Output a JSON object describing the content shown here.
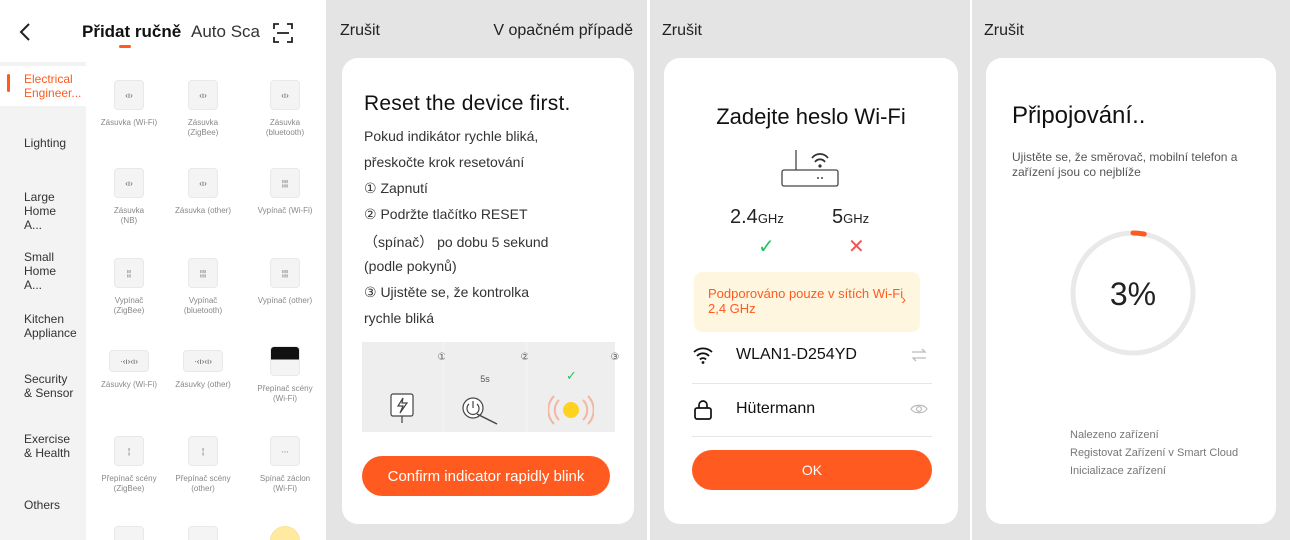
{
  "panel1": {
    "tabs": {
      "active": "Přidat ručně",
      "inactive": "Auto Sca"
    },
    "sidebar": [
      "Electrical Engineer...",
      "Lighting",
      "Large Home A...",
      "Small Home A...",
      "Kitchen Appliance",
      "Security & Sensor",
      "Exercise & Health",
      "Others"
    ],
    "devices": [
      {
        "name": "Zásuvka (Wi-Fi)",
        "sub": ""
      },
      {
        "name": "Zásuvka",
        "sub": "(ZigBee)"
      },
      {
        "name": "Zásuvka",
        "sub": "(bluetooth)"
      },
      {
        "name": "Zásuvka",
        "sub": "(NB)"
      },
      {
        "name": "Zásuvka (other)",
        "sub": ""
      },
      {
        "name": "Vypínač (Wi-Fi)",
        "sub": ""
      },
      {
        "name": "Vypínač",
        "sub": "(ZigBee)"
      },
      {
        "name": "Vypínač",
        "sub": "(bluetooth)"
      },
      {
        "name": "Vypínač (other)",
        "sub": ""
      },
      {
        "name": "Zásuvky (Wi-Fi)",
        "sub": ""
      },
      {
        "name": "Zásuvky (other)",
        "sub": ""
      },
      {
        "name": "Přepínač scény",
        "sub": "(Wi-Fi)"
      },
      {
        "name": "Přepínač scény",
        "sub": "(ZigBee)"
      },
      {
        "name": "Přepínač scény",
        "sub": "(other)"
      },
      {
        "name": "Spínač záclon",
        "sub": "(Wi-Fi)"
      }
    ],
    "accent": "#ff5a1f"
  },
  "panel2": {
    "cancel": "Zrušit",
    "otherwise": "V opačném případě",
    "title": "Reset the device first.",
    "lines": [
      "Pokud indikátor rychle bliká,",
      "přeskočte krok resetování",
      "① Zapnutí",
      "② Podržte tlačítko RESET",
      "（spínač） po dobu 5 sekund",
      "(podle pokynů)",
      "③ Ujistěte se, že kontrolka",
      "rychle bliká"
    ],
    "steps": [
      "①",
      "②",
      "③"
    ],
    "step2_time": "5s",
    "confirm": "Confirm indicator rapidly blink"
  },
  "panel3": {
    "cancel": "Zrušit",
    "title": "Zadejte heslo Wi-Fi",
    "band_24": {
      "num": "2.4",
      "unit": "GHz"
    },
    "band_5": {
      "num": "5",
      "unit": "GHz"
    },
    "notice": "Podporováno pouze v sítích Wi-Fi 2,4 GHz",
    "ssid": "WLAN1-D254YD",
    "password": "Hütermann",
    "ok": "OK"
  },
  "panel4": {
    "cancel": "Zrušit",
    "title": "Připojování..",
    "subtitle": "Ujistěte se, že směrovač, mobilní telefon a zařízení jsou co nejblíže",
    "percent": "3%",
    "progress": 0.03,
    "status": [
      "Nalezeno zařízení",
      "Registovat Zařízení  v Smart Cloud",
      "Inicializace zařízení"
    ]
  }
}
